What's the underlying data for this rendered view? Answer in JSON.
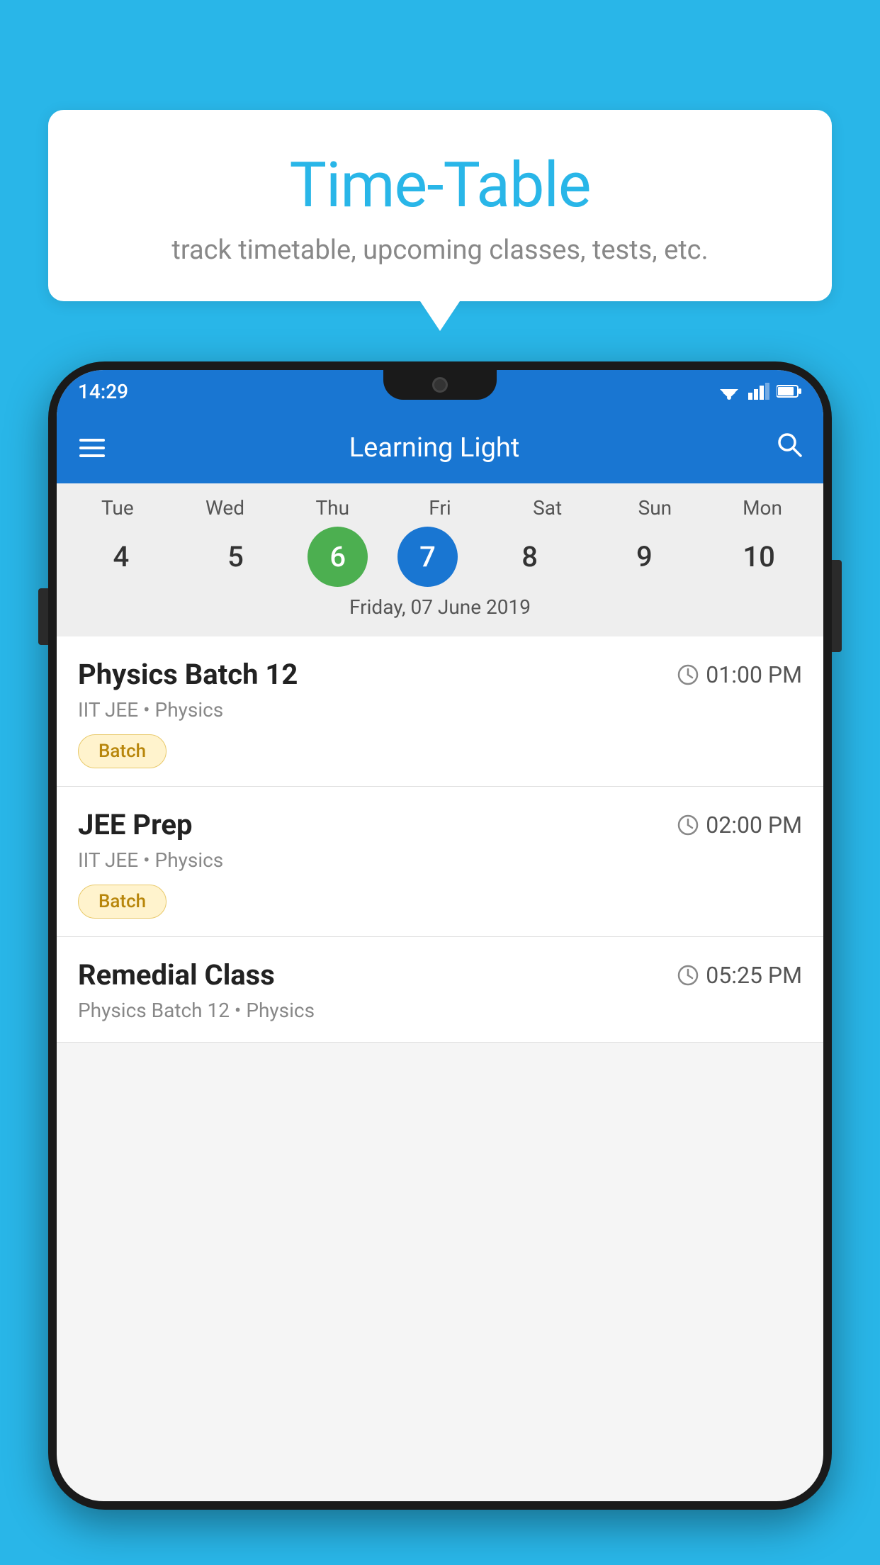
{
  "background_color": "#29b6e8",
  "bubble": {
    "title": "Time-Table",
    "subtitle": "track timetable, upcoming classes, tests, etc."
  },
  "phone": {
    "status_bar": {
      "time": "14:29"
    },
    "app_bar": {
      "title": "Learning Light"
    },
    "calendar": {
      "days": [
        {
          "name": "Tue",
          "num": "4",
          "state": "normal"
        },
        {
          "name": "Wed",
          "num": "5",
          "state": "normal"
        },
        {
          "name": "Thu",
          "num": "6",
          "state": "today"
        },
        {
          "name": "Fri",
          "num": "7",
          "state": "selected"
        },
        {
          "name": "Sat",
          "num": "8",
          "state": "normal"
        },
        {
          "name": "Sun",
          "num": "9",
          "state": "normal"
        },
        {
          "name": "Mon",
          "num": "10",
          "state": "normal"
        }
      ],
      "selected_date_label": "Friday, 07 June 2019"
    },
    "schedule": [
      {
        "class_name": "Physics Batch 12",
        "time": "01:00 PM",
        "meta": "IIT JEE • Physics",
        "badge": "Batch"
      },
      {
        "class_name": "JEE Prep",
        "time": "02:00 PM",
        "meta": "IIT JEE • Physics",
        "badge": "Batch"
      },
      {
        "class_name": "Remedial Class",
        "time": "05:25 PM",
        "meta": "Physics Batch 12 • Physics",
        "badge": null
      }
    ]
  }
}
